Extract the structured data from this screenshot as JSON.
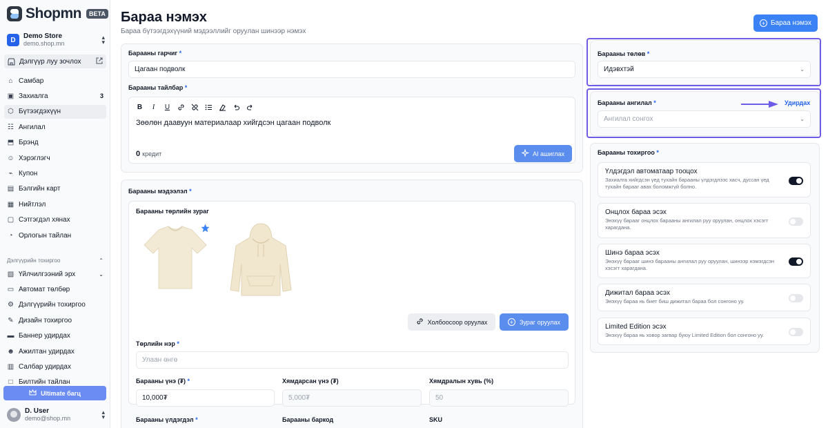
{
  "brand": {
    "name": "Shopmn",
    "badge": "BETA"
  },
  "store": {
    "initial": "D",
    "name": "Demo Store",
    "domain": "demo.shop.mn"
  },
  "visit_store": "Дэлгүүр луу зочлох",
  "nav": [
    {
      "label": "Самбар",
      "icon": "dashboard-icon"
    },
    {
      "label": "Захиалга",
      "icon": "orders-icon",
      "badge": "3"
    },
    {
      "label": "Бүтээгдэхүүн",
      "icon": "product-icon",
      "active": true
    },
    {
      "label": "Ангилал",
      "icon": "category-icon"
    },
    {
      "label": "Брэнд",
      "icon": "brand-icon"
    },
    {
      "label": "Хэрэглэгч",
      "icon": "users-icon"
    },
    {
      "label": "Купон",
      "icon": "coupon-icon"
    },
    {
      "label": "Бэлгийн карт",
      "icon": "gift-card-icon"
    },
    {
      "label": "Нийтлэл",
      "icon": "article-icon"
    },
    {
      "label": "Сэтгэгдэл хянах",
      "icon": "review-icon"
    },
    {
      "label": "Орлогын тайлан",
      "icon": "report-icon"
    }
  ],
  "settings_section": "Дэлгүүрийн тохиргоо",
  "nav2": [
    {
      "label": "Үйлчилгээний эрх",
      "icon": "license-icon",
      "chevron": true
    },
    {
      "label": "Автомат төлбөр",
      "icon": "auto-pay-icon"
    },
    {
      "label": "Дэлгүүрийн тохиргоо",
      "icon": "settings-icon"
    },
    {
      "label": "Дизайн тохиргоо",
      "icon": "design-icon"
    },
    {
      "label": "Баннер удирдах",
      "icon": "banner-icon"
    },
    {
      "label": "Ажилтан удирдах",
      "icon": "staff-icon"
    },
    {
      "label": "Салбар удирдах",
      "icon": "branch-icon"
    },
    {
      "label": "Билтийн тайлан",
      "icon": "extra-icon"
    }
  ],
  "ultimate": "Ultimate багц",
  "user": {
    "name": "D. User",
    "email": "demo@shop.mn"
  },
  "page": {
    "title": "Бараа нэмэх",
    "subtitle": "Бараа бүтээгдэхүүний мэдээллийг оруулан шинээр нэмэх",
    "add_button": "Бараа нэмэх"
  },
  "form": {
    "title_label": "Барааны гарчиг",
    "title_value": "Цагаан подволк",
    "desc_label": "Барааны тайлбар",
    "desc_value": "Зөөлөн даавуун материалаар хийгдсэн цагаан подволк",
    "credit_count": "0",
    "credit_label": "кредит",
    "ai_button": "AI ашиглах",
    "info_label": "Барааны мэдээлэл",
    "image_label": "Барааны төрлийн зураг",
    "link_button": "Холбоосоор оруулах",
    "upload_button": "Зураг оруулах",
    "variant_label": "Төрлийн нэр",
    "variant_placeholder": "Улаан өнгө",
    "price_label": "Барааны үнэ (₮)",
    "price_value": "10,000₮",
    "discount_price_label": "Хямдарсан үнэ (₮)",
    "discount_price_placeholder": "5,000₮",
    "discount_rate_label": "Хямдралын хувь (%)",
    "discount_rate_placeholder": "50",
    "stock_label": "Барааны үлдэгдэл",
    "barcode_label": "Барааны баркод",
    "sku_label": "SKU"
  },
  "right": {
    "payment_label": "Барааны төлөв",
    "payment_value": "Идэвхтэй",
    "category_label": "Барааны ангилал",
    "category_manage": "Удирдах",
    "category_placeholder": "Ангилал сонгох",
    "settings_label": "Барааны тохиргоо",
    "settings": [
      {
        "title": "Үлдэгдэл автоматаар тооцох",
        "desc": "Захиалга хийгдсэн үед тухайн барааны үлдэгдлээс хасч, дуссан үед тухайн барааг авах боломжгүй болно.",
        "on": true
      },
      {
        "title": "Онцлох бараа эсэх",
        "desc": "Энэхүү барааг онцлох барааны ангилал руу оруулан, онцлох хэсэгт харагдана.",
        "on": false
      },
      {
        "title": "Шинэ бараа эсэх",
        "desc": "Энэхүү барааг шинэ барааны ангилал руу оруулан, шинээр нэмэгдсэн хэсэгт харагдана.",
        "on": true
      },
      {
        "title": "Дижитал бараа эсэх",
        "desc": "Энэхүү бараа нь биет биш дижитал бараа бол сонгоно уу.",
        "on": false
      },
      {
        "title": "Limited Edition эсэх",
        "desc": "Энэхүү бараа нь ховор загвар буюу Limited Edition бол сонгоно уу.",
        "on": false
      }
    ]
  },
  "colors": {
    "accent": "#3b82f6",
    "highlight": "#6d5ce7",
    "toggle_on": "#111827"
  }
}
